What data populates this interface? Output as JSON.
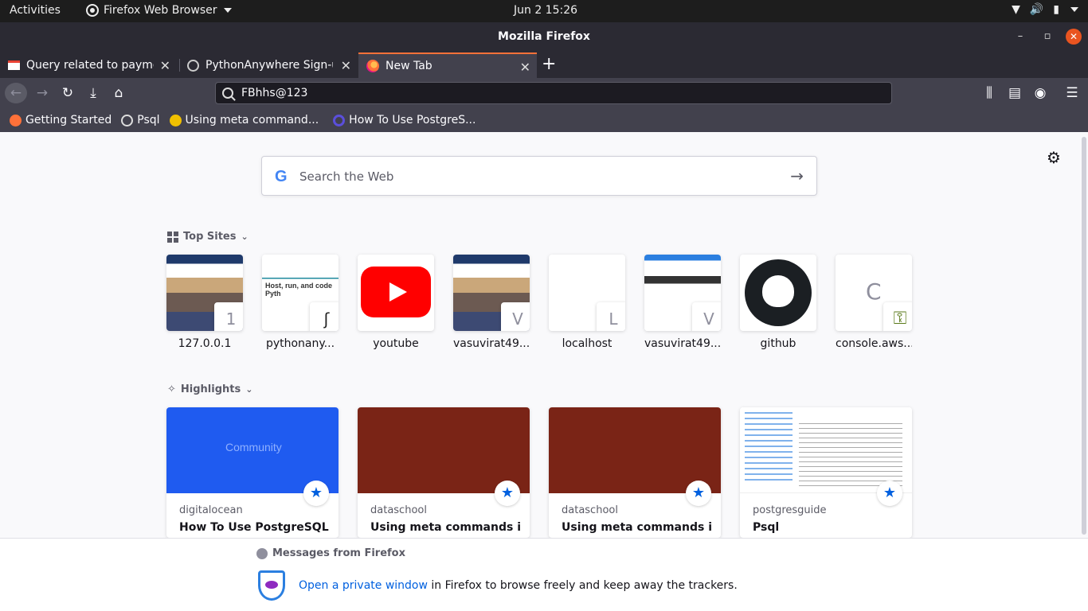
{
  "system_bar": {
    "activities": "Activities",
    "app_name": "Firefox Web Browser",
    "clock": "Jun 2  15:26"
  },
  "window": {
    "title": "Mozilla Firefox",
    "minimize": "–",
    "maximize": "▫",
    "close": "✕"
  },
  "tabs": [
    {
      "label": "Query related to paymen",
      "icon": "gmail-icon"
    },
    {
      "label": "PythonAnywhere Sign-up",
      "icon": "pythonanywhere-icon"
    },
    {
      "label": "New Tab",
      "icon": "firefox-icon",
      "active": true
    }
  ],
  "navbar": {
    "url_value": "FBhhs@123"
  },
  "bookmarks": [
    {
      "label": "Getting Started",
      "color": "#ff7139"
    },
    {
      "label": "Psql",
      "color": "#cccccc"
    },
    {
      "label": "Using meta command...",
      "color": "#f0c000"
    },
    {
      "label": "How To Use PostgreS...",
      "color": "#5b4fdb"
    }
  ],
  "newtab": {
    "search_placeholder": "Search the Web",
    "google_letter": "G",
    "top_sites_heading": "Top Sites",
    "highlights_heading": "Highlights"
  },
  "top_sites": [
    {
      "label": "127.0.0.1",
      "letter": "1"
    },
    {
      "label": "pythonany...",
      "letter": ""
    },
    {
      "label": "youtube",
      "letter": ""
    },
    {
      "label": "vasuvirat49...",
      "letter": "V"
    },
    {
      "label": "localhost",
      "letter": "L"
    },
    {
      "label": "vasuvirat49...",
      "letter": "V"
    },
    {
      "label": "github",
      "letter": ""
    },
    {
      "label": "console.aws...",
      "letter": "C"
    }
  ],
  "highlights": [
    {
      "source": "digitalocean",
      "title": "How To Use PostgreSQL ...",
      "image_color": "#1f5bf0"
    },
    {
      "source": "dataschool",
      "title": "Using meta commands in ...",
      "image_color": "#7a2416"
    },
    {
      "source": "dataschool",
      "title": "Using meta commands in ...",
      "image_color": "#7a2416"
    },
    {
      "source": "postgresguide",
      "title": "Psql",
      "image_color": "#ffffff"
    }
  ],
  "messages": {
    "heading": "Messages from Firefox",
    "link_text": "Open a private window",
    "body_text": " in Firefox to browse freely and keep away the trackers."
  }
}
